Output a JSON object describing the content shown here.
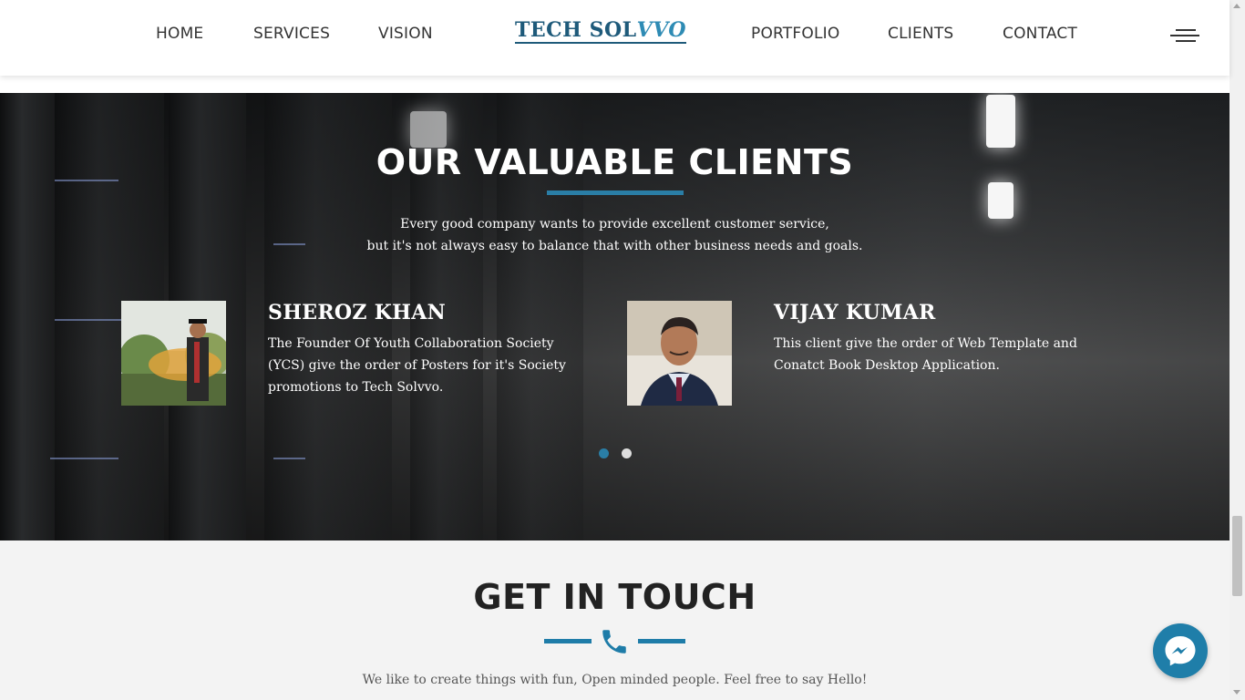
{
  "nav": {
    "left_links": [
      "HOME",
      "SERVICES",
      "VISION"
    ],
    "brand_part1": "TECH SOL",
    "brand_part2": "VVO",
    "right_links": [
      "PORTFOLIO",
      "CLIENTS",
      "CONTACT"
    ],
    "menu_icon": "hamburger-menu-icon"
  },
  "clients": {
    "title": "OUR VALUABLE CLIENTS",
    "subtitle_line1": "Every good company wants to provide excellent customer service,",
    "subtitle_line2": "but it's not always easy to balance that with other business needs and goals.",
    "items": [
      {
        "name": "SHEROZ KHAN",
        "desc_line1": "The Founder Of Youth Collaboration Society",
        "desc_line2": "(YCS) give the order of Posters for it's Society",
        "desc_line3": "promotions to Tech Solvvo."
      },
      {
        "name": "VIJAY KUMAR",
        "desc_line1": "This client give the order of Web Template and",
        "desc_line2": "Conatct Book Desktop Application.",
        "desc_line3": ""
      }
    ],
    "carousel": {
      "slides": 2,
      "active": 1
    },
    "accent_color": "#2a7ea6"
  },
  "contact": {
    "title": "GET IN TOUCH",
    "subtitle": "We like to create things with fun, Open minded people. Feel free to say Hello!",
    "icon": "phone-icon"
  },
  "messenger": {
    "icon": "messenger-icon"
  }
}
